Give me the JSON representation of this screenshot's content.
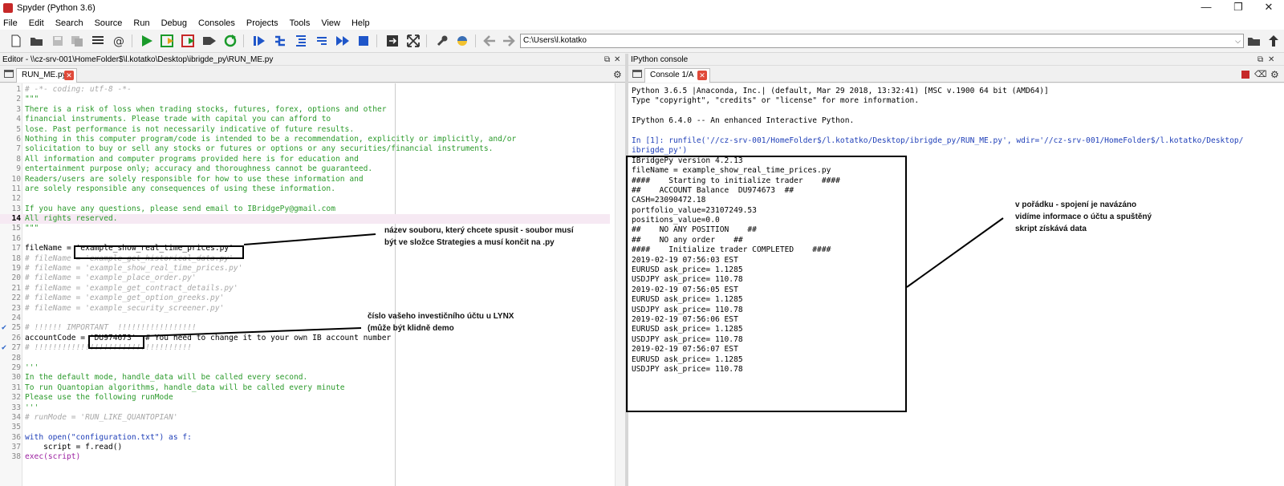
{
  "window": {
    "title": "Spyder (Python 3.6)",
    "minimize": "—",
    "restore": "❐",
    "close": "✕"
  },
  "menu": [
    "File",
    "Edit",
    "Search",
    "Source",
    "Run",
    "Debug",
    "Consoles",
    "Projects",
    "Tools",
    "View",
    "Help"
  ],
  "toolbar": {
    "path": "C:\\Users\\l.kotatko"
  },
  "editor": {
    "header": "Editor - \\\\cz-srv-001\\HomeFolder$\\l.kotatko\\Desktop\\ibrigde_py\\RUN_ME.py",
    "tab": "RUN_ME.py",
    "lines": [
      "# -*- coding: utf-8 -*-",
      "\"\"\"",
      "There is a risk of loss when trading stocks, futures, forex, options and other",
      "financial instruments. Please trade with capital you can afford to",
      "lose. Past performance is not necessarily indicative of future results.",
      "Nothing in this computer program/code is intended to be a recommendation, explicitly or implicitly, and/or",
      "solicitation to buy or sell any stocks or futures or options or any securities/financial instruments.",
      "All information and computer programs provided here is for education and",
      "entertainment purpose only; accuracy and thoroughness cannot be guaranteed.",
      "Readers/users are solely responsible for how to use these information and",
      "are solely responsible any consequences of using these information.",
      "",
      "If you have any questions, please send email to IBridgePy@gmail.com",
      "All rights reserved.",
      "\"\"\"",
      "",
      "fileName = 'example_show_real_time_prices.py'",
      "# fileName = 'example_get_historical_data.py'",
      "# fileName = 'example_show_real_time_prices.py'",
      "# fileName = 'example_place_order.py'",
      "# fileName = 'example_get_contract_details.py'",
      "# fileName = 'example_get_option_greeks.py'",
      "# fileName = 'example_security_screener.py'",
      "",
      "# !!!!!! IMPORTANT  !!!!!!!!!!!!!!!!!",
      "accountCode = 'DU974673'  # You need to change it to your own IB account number",
      "# !!!!!!!!!!!!!!!!!!!!!!!!!!!!!!!!!!",
      "",
      "'''",
      "In the default mode, handle_data will be called every second.",
      "To run Quantopian algorithms, handle_data will be called every minute",
      "Please use the following runMode",
      "'''",
      "# runMode = 'RUN_LIKE_QUANTOPIAN'",
      "",
      "with open(\"configuration.txt\") as f:",
      "    script = f.read()",
      "exec(script)"
    ]
  },
  "console": {
    "header": "IPython console",
    "tab": "Console 1/A",
    "lines": [
      "Python 3.6.5 |Anaconda, Inc.| (default, Mar 29 2018, 13:32:41) [MSC v.1900 64 bit (AMD64)]",
      "Type \"copyright\", \"credits\" or \"license\" for more information.",
      "",
      "IPython 6.4.0 -- An enhanced Interactive Python.",
      "",
      "In [1]: runfile('//cz-srv-001/HomeFolder$/l.kotatko/Desktop/ibrigde_py/RUN_ME.py', wdir='//cz-srv-001/HomeFolder$/l.kotatko/Desktop/",
      "ibrigde_py')",
      "IBridgePy version 4.2.13",
      "fileName = example_show_real_time_prices.py",
      "####    Starting to initialize trader    ####",
      "##    ACCOUNT Balance  DU974673  ##",
      "CASH=23090472.18",
      "portfolio_value=23107249.53",
      "positions_value=0.0",
      "##    NO ANY POSITION    ##",
      "##    NO any order    ##",
      "####    Initialize trader COMPLETED    ####",
      "2019-02-19 07:56:03 EST",
      "EURUSD ask_price= 1.1285",
      "USDJPY ask_price= 110.78",
      "2019-02-19 07:56:05 EST",
      "EURUSD ask_price= 1.1285",
      "USDJPY ask_price= 110.78",
      "2019-02-19 07:56:06 EST",
      "EURUSD ask_price= 1.1285",
      "USDJPY ask_price= 110.78",
      "2019-02-19 07:56:07 EST",
      "EURUSD ask_price= 1.1285",
      "USDJPY ask_price= 110.78"
    ]
  },
  "annotations": {
    "filename": [
      "název souboru, který chcete spusit - soubor musí",
      "být ve složce Strategies a musí končit na .py"
    ],
    "account": [
      "číslo vašeho investičního účtu u LYNX",
      "(může být klidně demo"
    ],
    "console": [
      "v pořádku - spojení je navázáno",
      "vidíme informace o účtu a spuštěný",
      "skript získává data"
    ]
  },
  "colors": {
    "run": "#1a9a2a",
    "stop": "#c62828",
    "blue": "#1f56c9"
  }
}
